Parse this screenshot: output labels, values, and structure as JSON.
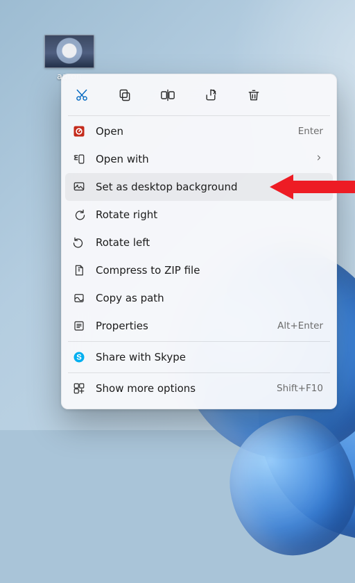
{
  "desktop": {
    "icon_label": "aaron"
  },
  "iconbar": {
    "cut": "cut-icon",
    "copy": "copy-icon",
    "rename": "rename-icon",
    "share": "share-icon",
    "delete": "delete-icon"
  },
  "menu": {
    "open": {
      "label": "Open",
      "accel": "Enter"
    },
    "open_with": {
      "label": "Open with"
    },
    "set_background": {
      "label": "Set as desktop background"
    },
    "rotate_right": {
      "label": "Rotate right"
    },
    "rotate_left": {
      "label": "Rotate left"
    },
    "compress_zip": {
      "label": "Compress to ZIP file"
    },
    "copy_as_path": {
      "label": "Copy as path"
    },
    "properties": {
      "label": "Properties",
      "accel": "Alt+Enter"
    },
    "share_skype": {
      "label": "Share with Skype"
    },
    "more_options": {
      "label": "Show more options",
      "accel": "Shift+F10"
    }
  }
}
